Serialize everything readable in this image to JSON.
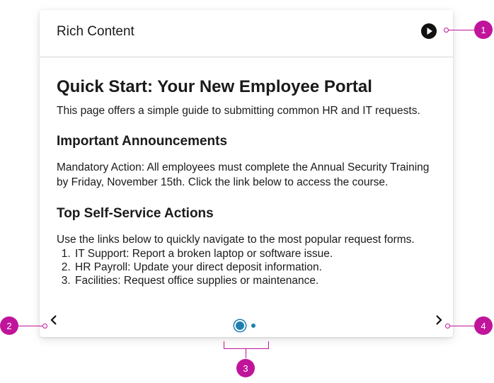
{
  "card": {
    "title": "Rich Content",
    "play_icon": "play-circle-icon"
  },
  "content": {
    "heading": "Quick Start: Your New Employee Portal",
    "intro": "This page offers a simple guide to submitting common HR and IT requests.",
    "section1_heading": "Important Announcements",
    "section1_text": "Mandatory Action: All employees must complete the Annual Security Training by Friday, November 15th. Click the link below to access the course.",
    "section2_heading": "Top Self-Service Actions",
    "section2_text": "Use the links below to quickly navigate to the most popular request forms.",
    "list": [
      "IT Support: Report a broken laptop or software issue.",
      "HR Payroll: Update your direct deposit information.",
      "Facilities: Request office supplies or maintenance."
    ]
  },
  "pagination": {
    "pages": 2,
    "active_page": 1
  },
  "callouts": [
    "1",
    "2",
    "3",
    "4"
  ],
  "colors": {
    "accent": "#1e7fb0",
    "callout": "#c0149b"
  }
}
